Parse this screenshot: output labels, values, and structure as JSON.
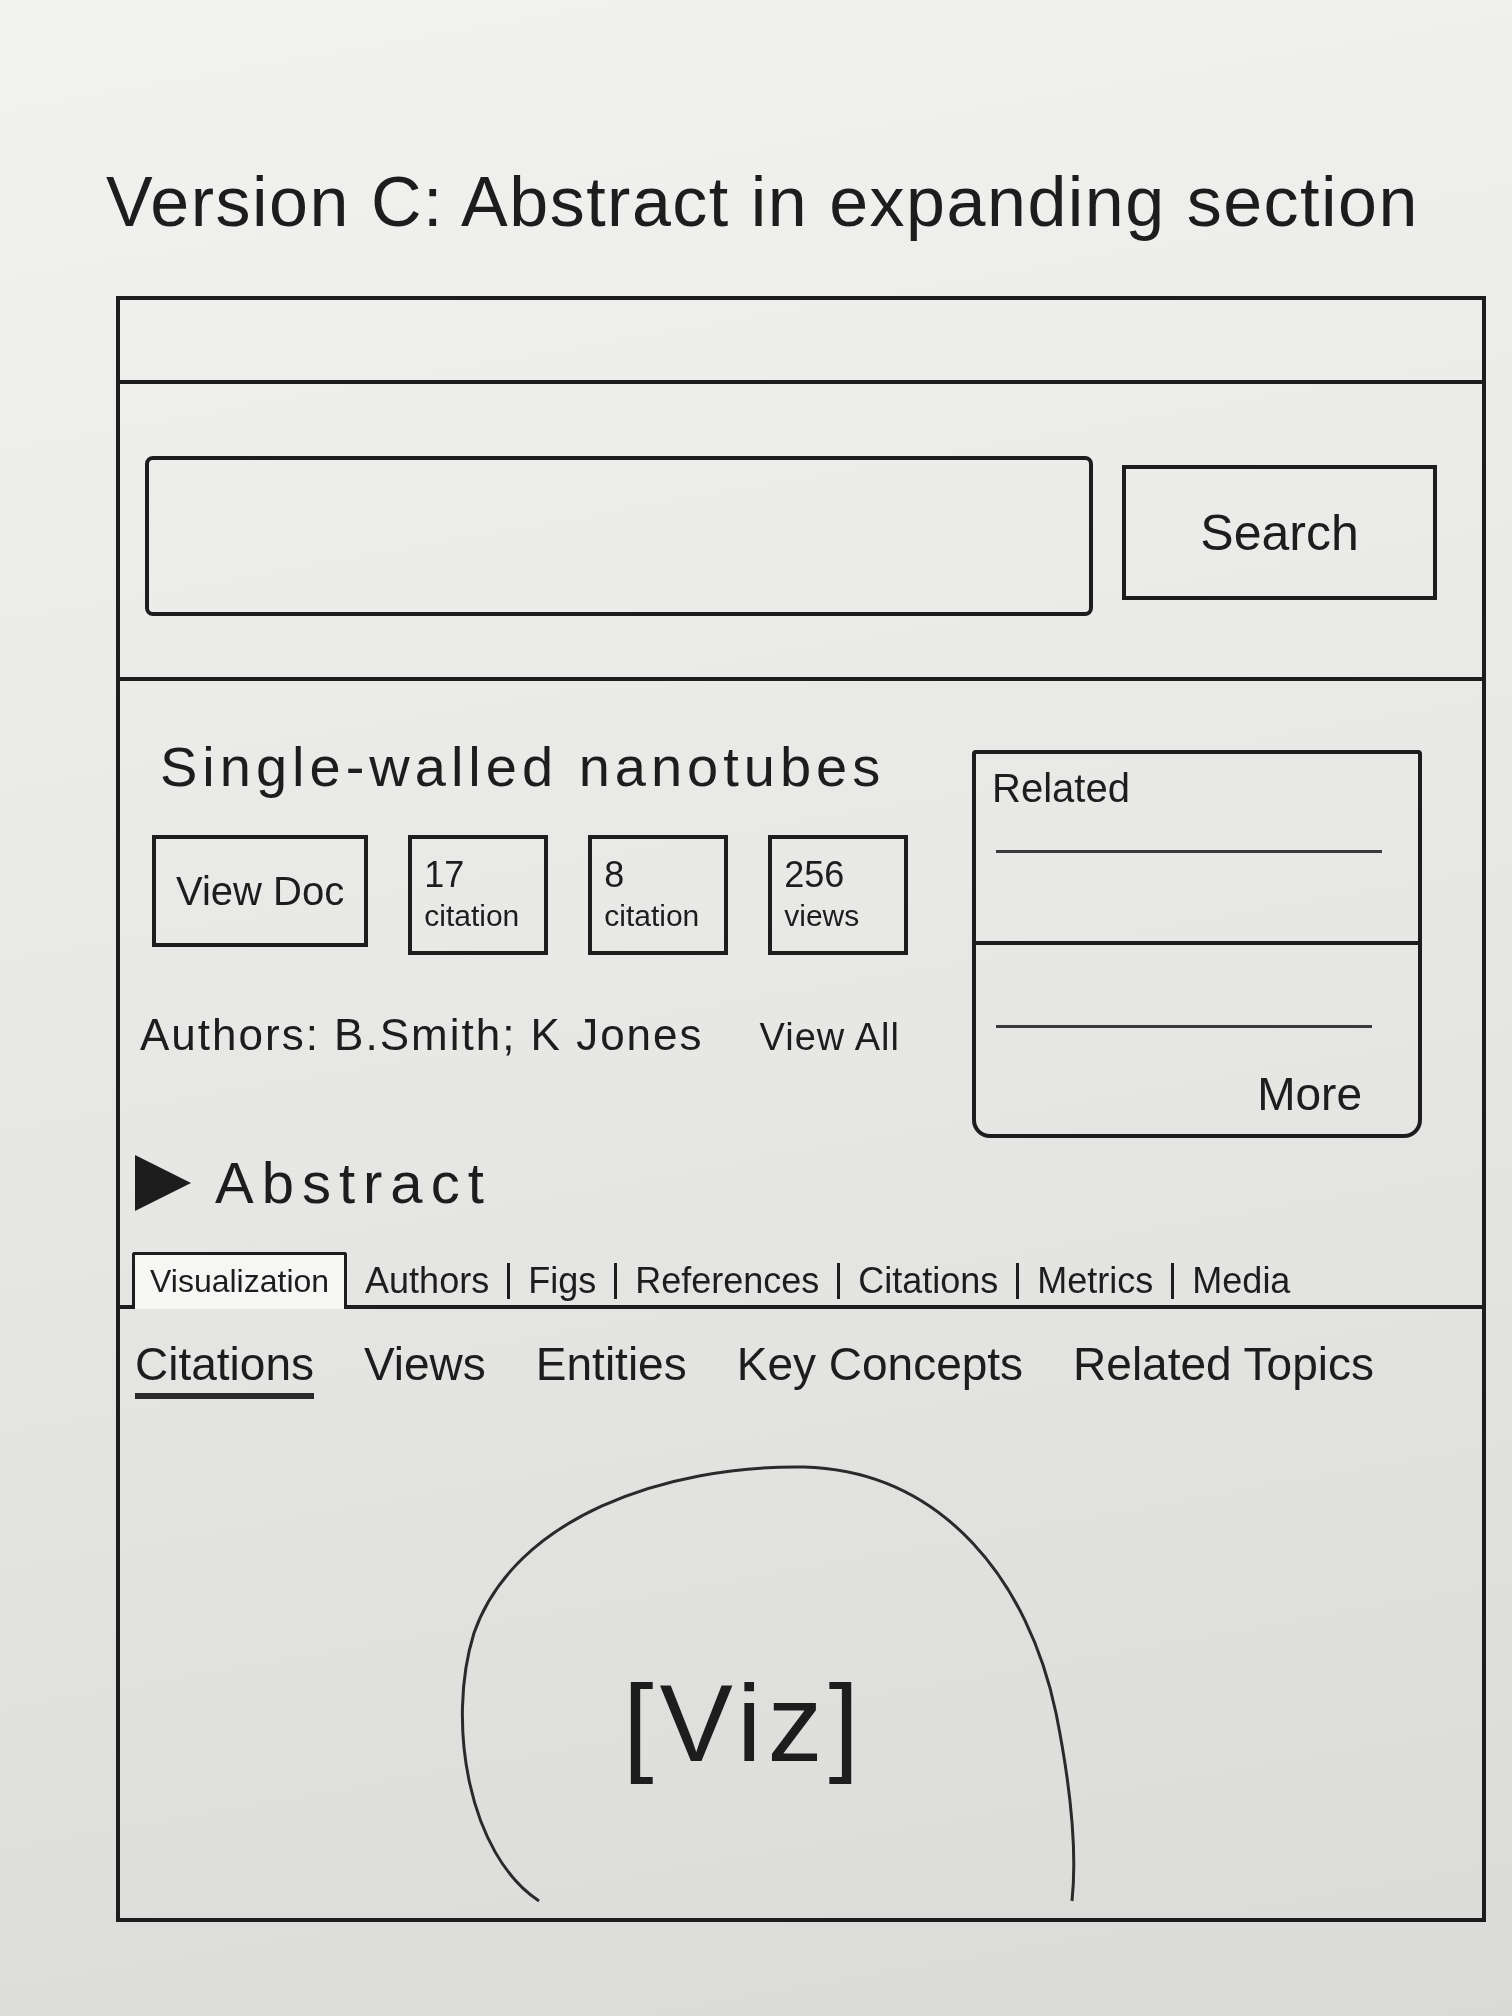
{
  "page_title": "Version C: Abstract in expanding section",
  "search": {
    "button": "Search"
  },
  "document": {
    "title": "Single-walled nanotubes",
    "actions": [
      {
        "kind": "button",
        "label": "View Doc"
      },
      {
        "kind": "metric",
        "value": "17",
        "label": "citation"
      },
      {
        "kind": "metric",
        "value": "8",
        "label": "citation"
      },
      {
        "kind": "metric",
        "value": "256",
        "label": "views"
      }
    ],
    "authors": "Authors: B.Smith; K Jones",
    "authors_link": "View All"
  },
  "related": {
    "title": "Related",
    "more": "More"
  },
  "abstract": {
    "label": "Abstract",
    "expanded": false
  },
  "tabs": [
    {
      "label": "Visualization",
      "selected": true
    },
    {
      "label": "Authors",
      "selected": false
    },
    {
      "label": "Figs",
      "selected": false
    },
    {
      "label": "References",
      "selected": false
    },
    {
      "label": "Citations",
      "selected": false
    },
    {
      "label": "Metrics",
      "selected": false
    },
    {
      "label": "Media",
      "selected": false
    }
  ],
  "subtabs": [
    {
      "label": "Citations",
      "selected": true
    },
    {
      "label": "Views",
      "selected": false
    },
    {
      "label": "Entities",
      "selected": false
    },
    {
      "label": "Key Concepts",
      "selected": false
    },
    {
      "label": "Related Topics",
      "selected": false
    }
  ],
  "visualization": {
    "label": "[Viz]"
  }
}
